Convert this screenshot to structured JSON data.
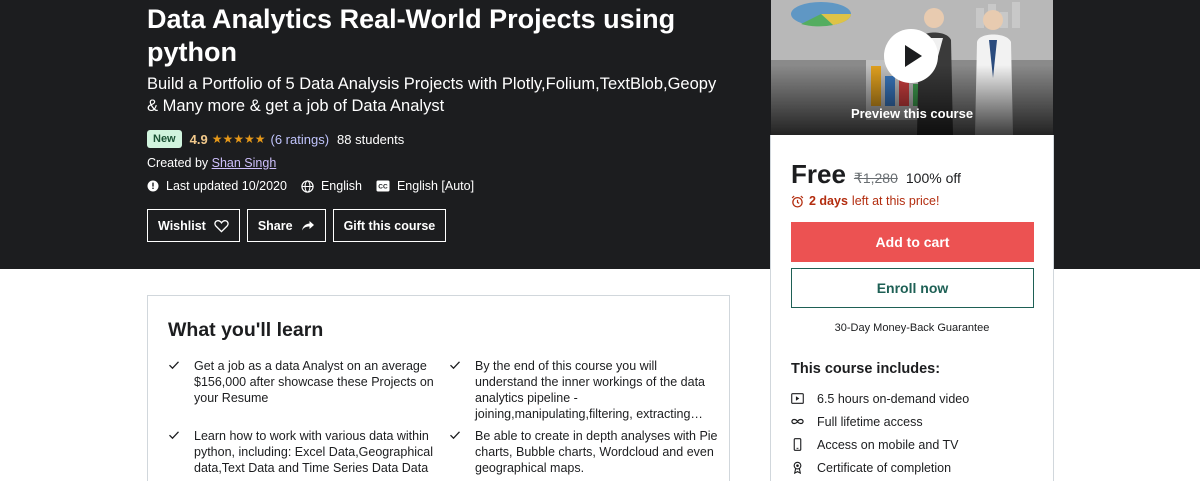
{
  "course": {
    "title": "Data Analytics Real-World Projects using python",
    "subtitle": "Build a Portfolio of 5 Data Analysis Projects with Plotly,Folium,TextBlob,Geopy & Many more & get a job of Data Analyst",
    "badge": "New",
    "rating": "4.9",
    "stars": 5,
    "rating_count": "(6 ratings)",
    "students": "88 students",
    "created_by_label": "Created by",
    "instructor": "Shan Singh",
    "last_updated": "Last updated 10/2020",
    "language": "English",
    "captions": "English [Auto]"
  },
  "actions": {
    "wishlist": "Wishlist",
    "share": "Share",
    "gift": "Gift this course"
  },
  "preview": {
    "label": "Preview this course"
  },
  "pricing": {
    "current": "Free",
    "original": "₹1,280",
    "discount": "100% off",
    "timer_bold": "2 days",
    "timer_rest": "left at this price!",
    "add_to_cart": "Add to cart",
    "enroll": "Enroll now",
    "guarantee": "30-Day Money-Back Guarantee"
  },
  "includes": {
    "title": "This course includes:",
    "items": [
      {
        "icon": "video-icon",
        "label": "6.5 hours on-demand video"
      },
      {
        "icon": "infinity-icon",
        "label": "Full lifetime access"
      },
      {
        "icon": "mobile-icon",
        "label": "Access on mobile and TV"
      },
      {
        "icon": "certificate-icon",
        "label": "Certificate of completion"
      }
    ]
  },
  "learn": {
    "title": "What you'll learn",
    "items": [
      "Get a job as a data Analyst on an average $156,000 after showcase these Projects on your Resume",
      "By the end of this course you will understand the inner workings of the data analytics pipeline - joining,manipulating,filtering, extracting…",
      "Learn how to work with various data within python, including: Excel Data,Geographical data,Text Data and Time Series Data Data",
      "Be able to create in depth analyses with Pie charts, Bubble charts, Wordcloud and even geographical maps."
    ]
  },
  "colors": {
    "hero_bg": "#1c1d1f",
    "cart_button": "#ec5252",
    "enroll_border": "#1e6055",
    "badge_bg": "#d1f4de",
    "star": "#e59819",
    "timer_text": "#b32d0f"
  }
}
